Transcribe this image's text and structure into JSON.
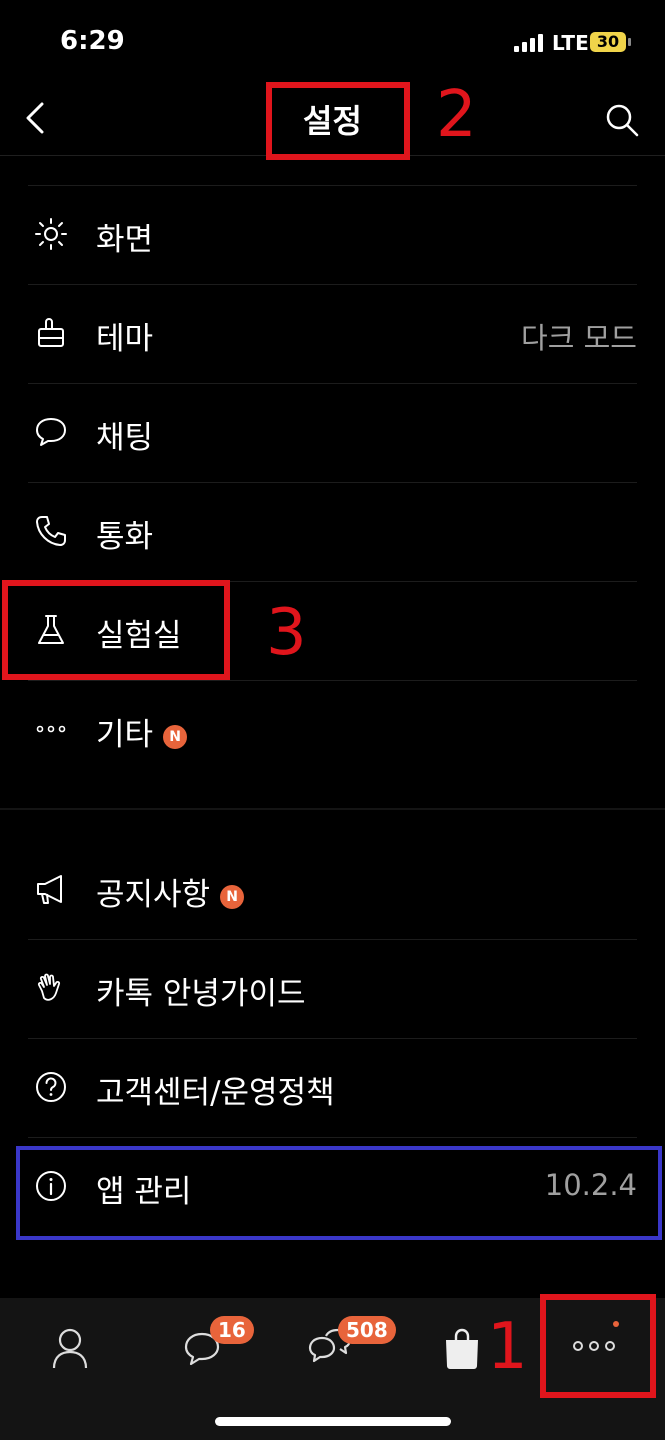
{
  "status": {
    "time": "6:29",
    "network": "LTE",
    "battery": "30"
  },
  "header": {
    "title": "설정"
  },
  "menu": [
    {
      "icon": "brightness-icon",
      "label": "화면",
      "value": ""
    },
    {
      "icon": "brush-icon",
      "label": "테마",
      "value": "다크 모드"
    },
    {
      "icon": "chat-bubble-icon",
      "label": "채팅",
      "value": ""
    },
    {
      "icon": "phone-icon",
      "label": "통화",
      "value": ""
    },
    {
      "icon": "flask-icon",
      "label": "실험실",
      "value": ""
    },
    {
      "icon": "more-dots-icon",
      "label": "기타",
      "value": "",
      "badge": "N"
    }
  ],
  "menu2": [
    {
      "icon": "megaphone-icon",
      "label": "공지사항",
      "value": "",
      "badge": "N"
    },
    {
      "icon": "hand-wave-icon",
      "label": "카톡 안녕가이드",
      "value": ""
    },
    {
      "icon": "question-circle-icon",
      "label": "고객센터/운영정책",
      "value": ""
    },
    {
      "icon": "info-circle-icon",
      "label": "앱 관리",
      "value": "10.2.4"
    }
  ],
  "annotations": {
    "n1": "1",
    "n2": "2",
    "n3": "3"
  },
  "tabbar": {
    "items": [
      {
        "icon": "person-icon",
        "badge": ""
      },
      {
        "icon": "chat-icon",
        "badge": "16"
      },
      {
        "icon": "open-chat-icon",
        "badge": "508"
      },
      {
        "icon": "shopping-bag-icon",
        "badge": ""
      },
      {
        "icon": "more-icon",
        "badge": ""
      }
    ]
  },
  "colors": {
    "accent": "#e8643b",
    "annotation_red": "#e0151c",
    "annotation_blue": "#3a37c9"
  }
}
